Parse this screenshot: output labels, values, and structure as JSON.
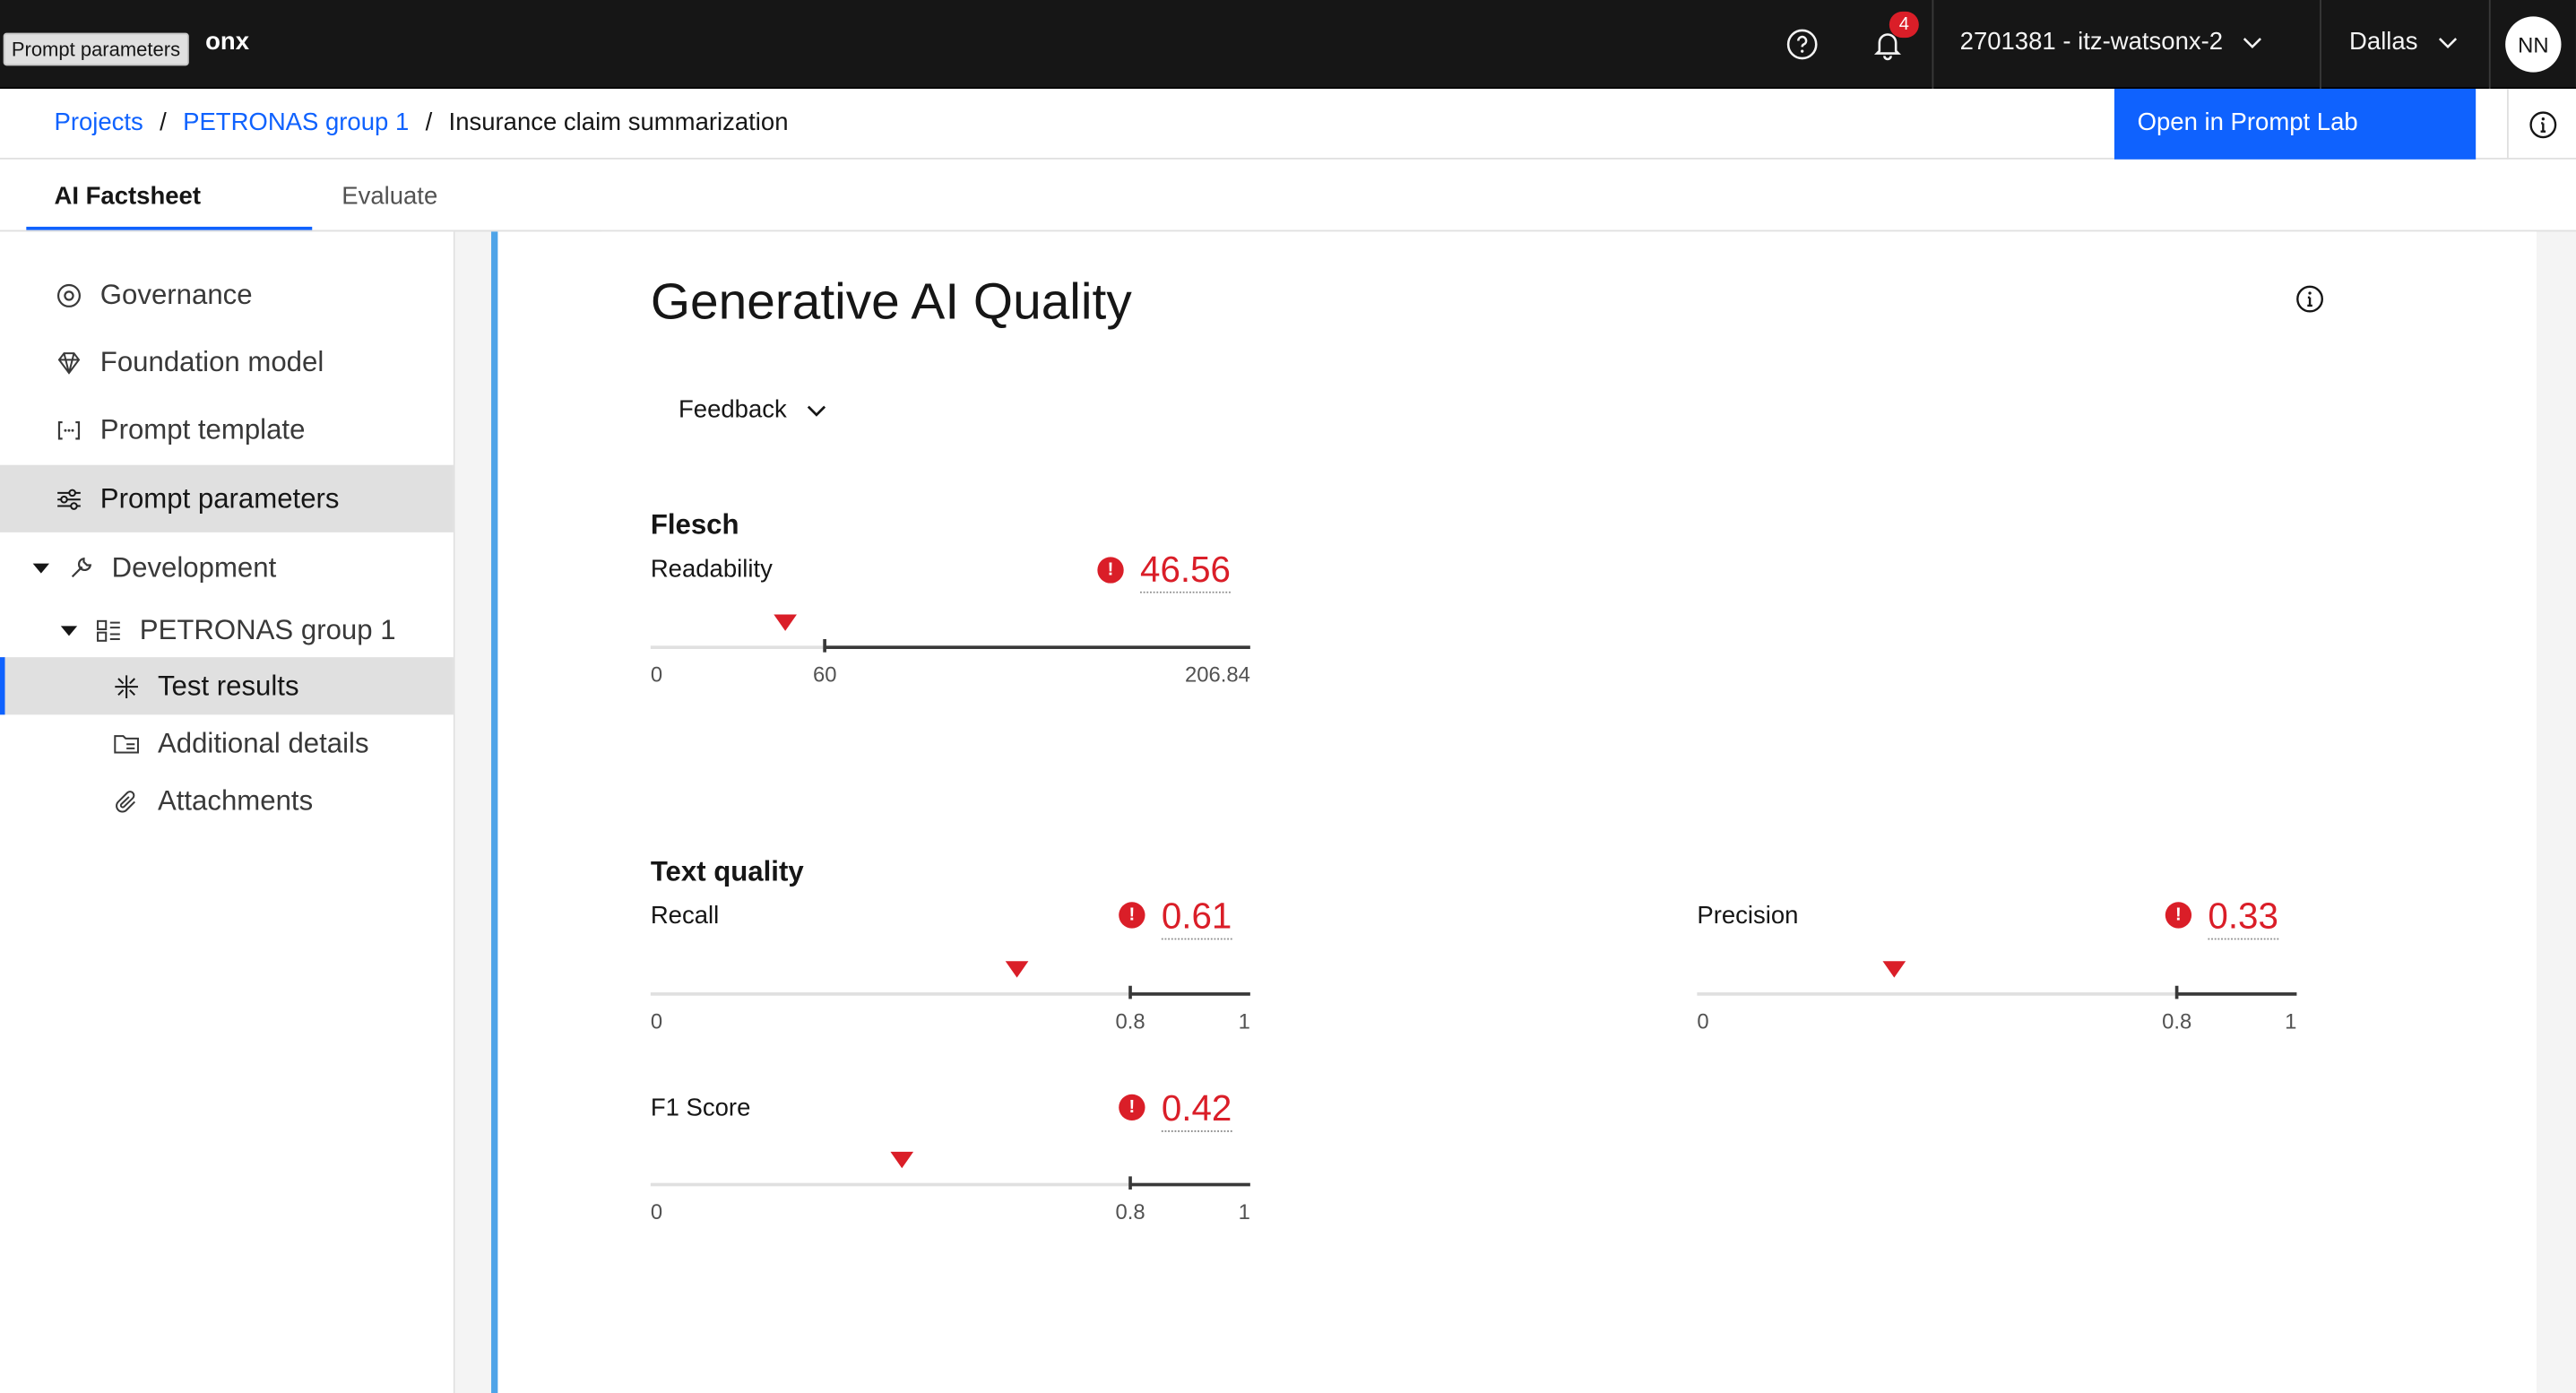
{
  "app": {
    "brand": "onx",
    "tooltip": "Prompt parameters",
    "notification_count": "4",
    "account": "2701381 - itz-watsonx-2",
    "region": "Dallas",
    "user_initials": "NN"
  },
  "breadcrumb": {
    "items": [
      "Projects",
      "PETRONAS group 1",
      "Insurance claim summarization"
    ],
    "separator": "/"
  },
  "actions": {
    "open_prompt_lab": "Open in Prompt Lab"
  },
  "tabs": [
    "AI Factsheet",
    "Evaluate"
  ],
  "sidebar": {
    "items": [
      "Governance",
      "Foundation model",
      "Prompt template",
      "Prompt parameters",
      "Development"
    ],
    "group": "PETRONAS group 1",
    "subitems": [
      "Test results",
      "Additional details",
      "Attachments"
    ]
  },
  "main": {
    "title": "Generative AI Quality",
    "dropdown": "Feedback",
    "flesch": {
      "heading": "Flesch",
      "label": "Readability",
      "value": "46.56",
      "value_num": 46.56,
      "scale": {
        "min": "0",
        "threshold": "60",
        "max": "206.84",
        "min_num": 0,
        "threshold_num": 60,
        "max_num": 206.84
      }
    },
    "text_quality": {
      "heading": "Text quality",
      "recall": {
        "label": "Recall",
        "value": "0.61",
        "value_num": 0.61
      },
      "precision": {
        "label": "Precision",
        "value": "0.33",
        "value_num": 0.33
      },
      "f1": {
        "label": "F1 Score",
        "value": "0.42",
        "value_num": 0.42
      },
      "scale": {
        "min": "0",
        "threshold": "0.8",
        "max": "1",
        "min_num": 0,
        "threshold_num": 0.8,
        "max_num": 1
      }
    }
  },
  "colors": {
    "primary": "#0f62fe",
    "error": "#da1e28",
    "topbar": "#161616",
    "panel_accent": "#4fa4e8"
  }
}
